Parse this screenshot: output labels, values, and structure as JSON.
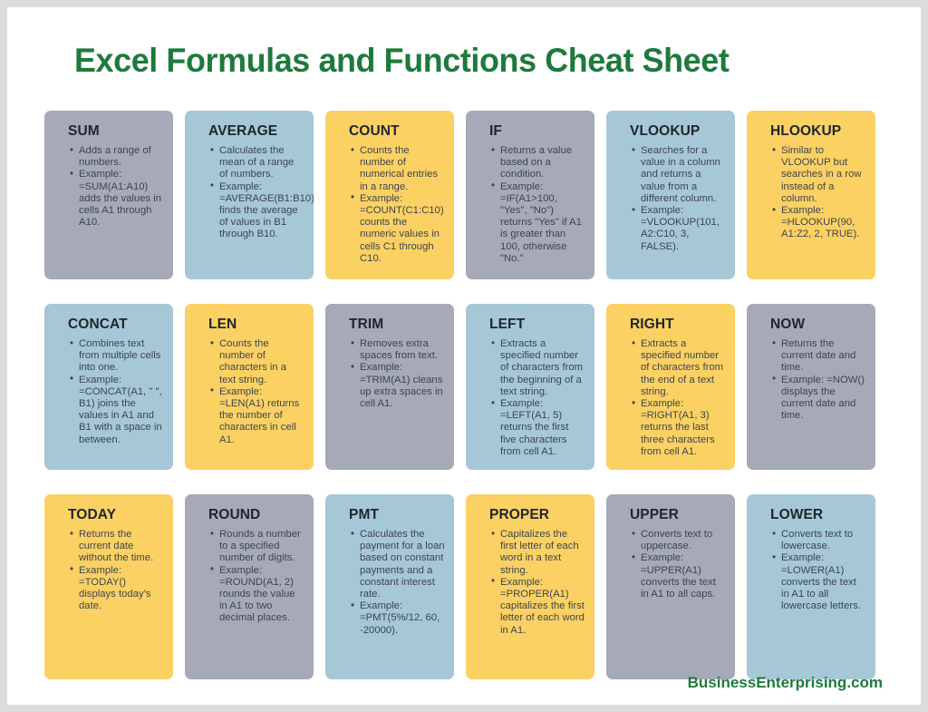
{
  "document": {
    "title": "Excel Formulas and Functions Cheat Sheet",
    "footer": "BusinessEnterprising.com",
    "colors": {
      "title_green": "#1e7a3c",
      "card_gray": "#a5a9b8",
      "card_teal": "#a6c7d6",
      "card_yellow": "#fcd163",
      "body_text": "#3c4650",
      "page_background": "#ffffff",
      "frame": "#dcdcdc"
    }
  },
  "rows": [
    {
      "cards": [
        {
          "title": "SUM",
          "color": "gray",
          "bullets": [
            "Adds a range of numbers.",
            "Example: =SUM(A1:A10) adds the values in cells A1 through A10."
          ]
        },
        {
          "title": "AVERAGE",
          "color": "teal",
          "bullets": [
            "Calculates the mean of a range of numbers.",
            "Example: =AVERAGE(B1:B10) finds the average of values in B1 through B10."
          ]
        },
        {
          "title": "COUNT",
          "color": "yellow",
          "bullets": [
            "Counts the number of numerical entries in a range.",
            "Example: =COUNT(C1:C10) counts the numeric values in cells C1 through C10."
          ]
        },
        {
          "title": "IF",
          "color": "gray",
          "bullets": [
            "Returns a value based on a condition.",
            "Example: =IF(A1>100, \"Yes\", \"No\") returns \"Yes\" if A1 is greater than 100, otherwise \"No.\""
          ]
        },
        {
          "title": "VLOOKUP",
          "color": "teal",
          "bullets": [
            "Searches for a value in a column and returns a value from a different column.",
            "Example: =VLOOKUP(101, A2:C10, 3, FALSE)."
          ]
        },
        {
          "title": "HLOOKUP",
          "color": "yellow",
          "bullets": [
            "Similar to VLOOKUP but searches in a row instead of a column.",
            "Example: =HLOOKUP(90, A1:Z2, 2, TRUE)."
          ]
        }
      ]
    },
    {
      "cards": [
        {
          "title": "CONCAT",
          "color": "teal",
          "bullets": [
            "Combines text from multiple cells into one.",
            "Example: =CONCAT(A1, \" \", B1) joins the values in A1 and B1 with a space in between."
          ]
        },
        {
          "title": "LEN",
          "color": "yellow",
          "bullets": [
            "Counts the number of characters in a text string.",
            "Example: =LEN(A1) returns the number of characters in cell A1."
          ]
        },
        {
          "title": "TRIM",
          "color": "gray",
          "bullets": [
            "Removes extra spaces from text.",
            "Example: =TRIM(A1) cleans up extra spaces in cell A1."
          ]
        },
        {
          "title": "LEFT",
          "color": "teal",
          "bullets": [
            "Extracts a specified number of characters from the beginning of a text string.",
            "Example: =LEFT(A1, 5) returns the first five characters from cell A1."
          ]
        },
        {
          "title": "RIGHT",
          "color": "yellow",
          "bullets": [
            "Extracts a specified number of characters from the end of a text string.",
            "Example: =RIGHT(A1, 3) returns the last three characters from cell A1."
          ]
        },
        {
          "title": "NOW",
          "color": "gray",
          "bullets": [
            "Returns the current date and time.",
            "Example: =NOW() displays the current date and time."
          ]
        }
      ]
    },
    {
      "cards": [
        {
          "title": "TODAY",
          "color": "yellow",
          "bullets": [
            "Returns the current date without the time.",
            "Example: =TODAY() displays today’s date."
          ]
        },
        {
          "title": "ROUND",
          "color": "gray",
          "bullets": [
            "Rounds a number to a specified number of digits.",
            "Example: =ROUND(A1, 2) rounds the value in A1 to two decimal places."
          ]
        },
        {
          "title": "PMT",
          "color": "teal",
          "bullets": [
            "Calculates the payment for a loan based on constant payments and a constant interest rate.",
            "Example: =PMT(5%/12, 60, -20000)."
          ]
        },
        {
          "title": "PROPER",
          "color": "yellow",
          "bullets": [
            "Capitalizes the first letter of each word in a text string.",
            "Example: =PROPER(A1) capitalizes the first letter of each word in A1."
          ]
        },
        {
          "title": "UPPER",
          "color": "gray",
          "bullets": [
            "Converts text to uppercase.",
            "Example: =UPPER(A1) converts the text in A1 to all caps."
          ]
        },
        {
          "title": "LOWER",
          "color": "teal",
          "bullets": [
            "Converts text to lowercase.",
            "Example: =LOWER(A1) converts the text in A1 to all lowercase letters."
          ]
        }
      ]
    }
  ]
}
